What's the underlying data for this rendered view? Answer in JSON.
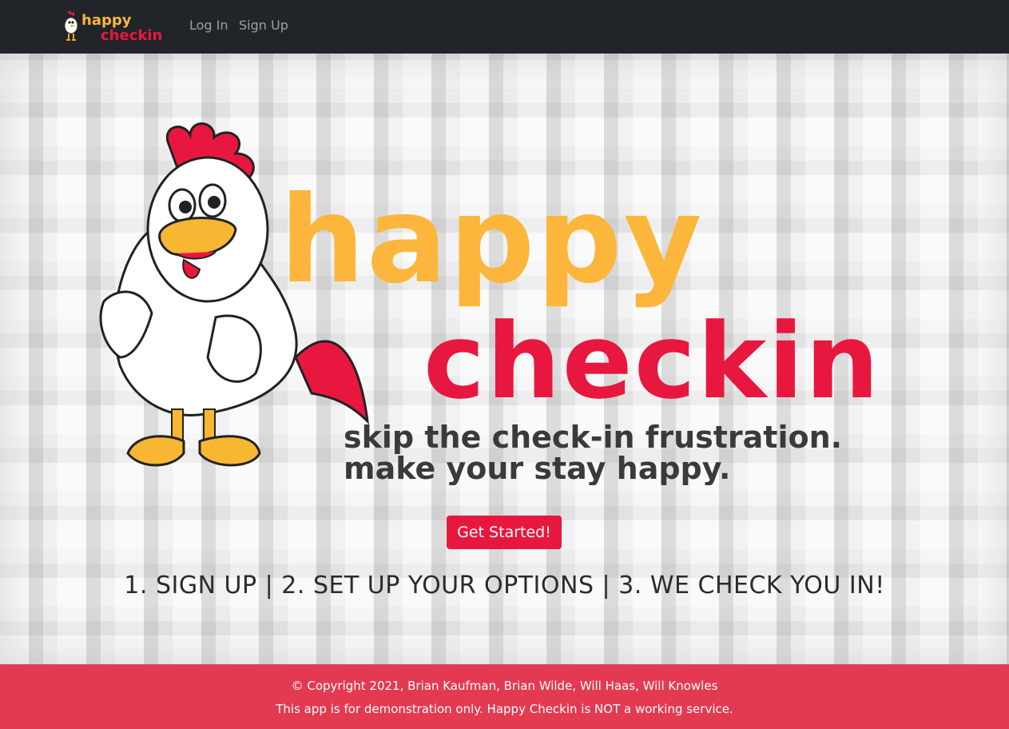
{
  "navbar": {
    "brand_line1": "happy",
    "brand_line2": "checkin",
    "login_label": "Log In",
    "signup_label": "Sign Up"
  },
  "hero": {
    "logo_word1": "happy",
    "logo_word2": "checkin",
    "tagline_line1": "skip the check-in frustration.",
    "tagline_line2": "make your stay happy.",
    "cta_label": "Get Started!",
    "steps_text": "1. SIGN UP | 2. SET UP YOUR OPTIONS | 3. WE CHECK YOU IN!"
  },
  "footer": {
    "copyright": "© Copyright 2021, Brian Kaufman, Brian Wilde, Will Haas, Will Knowles",
    "disclaimer": "This app is for demonstration only. Happy Checkin is NOT a working service."
  },
  "colors": {
    "brand_yellow": "#fbb63b",
    "brand_red": "#e8173f",
    "navbar_bg": "#212428",
    "footer_bg": "#e33a52"
  }
}
